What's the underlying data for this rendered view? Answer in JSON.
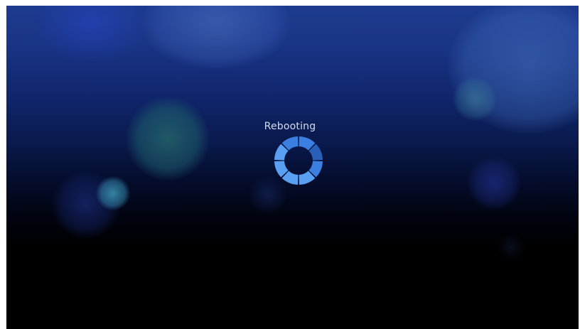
{
  "screen": {
    "status_text": "Rebooting"
  },
  "spinner": {
    "icon": "loading-spinner-icon",
    "segments": 8,
    "colors": {
      "bright": "#5aa0f2",
      "mid": "#3b7fe0",
      "dim": "#2a5fb8"
    }
  },
  "colors": {
    "background_top": "#1d3b8f",
    "background_bottom": "#000000",
    "frame_border": "#ffffff"
  }
}
